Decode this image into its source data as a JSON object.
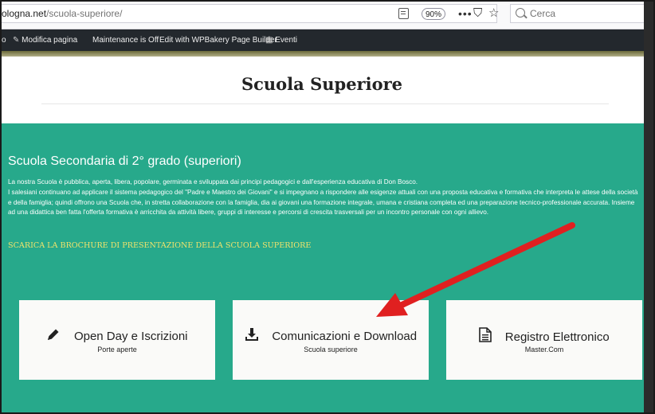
{
  "browser": {
    "url_host": "ologna.net",
    "url_path": "/scuola-superiore/",
    "zoom_level": "90%",
    "search_placeholder": "Cerca"
  },
  "admin_bar": {
    "partial_item": "o",
    "modify_page": "Modifica pagina",
    "maintenance": "Maintenance is Off",
    "wpbakery": "Edit with WPBakery Page Builder",
    "events": "Eventi"
  },
  "page": {
    "title": "Scuola Superiore"
  },
  "section": {
    "heading": "Scuola Secondaria di 2° grado (superiori)",
    "body": "La nostra Scuola è pubblica, aperta, libera, popolare, germinata e sviluppata dai principi pedagogici e dall'esperienza educativa di Don Bosco.\nI salesiani continuano ad applicare il sistema pedagogico del \"Padre e Maestro dei Giovani\" e si impegnano a rispondere alle esigenze attuali con una proposta educativa e formativa che interpreta le attese della società e della famiglia; quindi offrono una Scuola che, in stretta collaborazione con la famiglia, dia ai giovani una formazione integrale, umana e cristiana completa ed una preparazione tecnico-professionale accurata. Insieme ad una didattica ben fatta l'offerta formativa è arricchita da attività libere, gruppi di interesse e percorsi di crescita trasversali per un incontro personale con ogni allievo.",
    "brochure_link": "SCARICA LA BROCHURE DI PRESENTAZIONE DELLA SCUOLA SUPERIORE"
  },
  "cards": [
    {
      "title": "Open Day e Iscrizioni",
      "subtitle": "Porte aperte",
      "icon": "pencil-icon"
    },
    {
      "title": "Comunicazioni e Download",
      "subtitle": "Scuola superiore",
      "icon": "download-icon"
    },
    {
      "title": "Registro Elettronico",
      "subtitle": "Master.Com",
      "icon": "document-icon"
    }
  ],
  "colors": {
    "section_bg": "#27a98b",
    "link": "#f0e36b",
    "admin_bar": "#23282d",
    "annotation_arrow": "#e02020"
  }
}
